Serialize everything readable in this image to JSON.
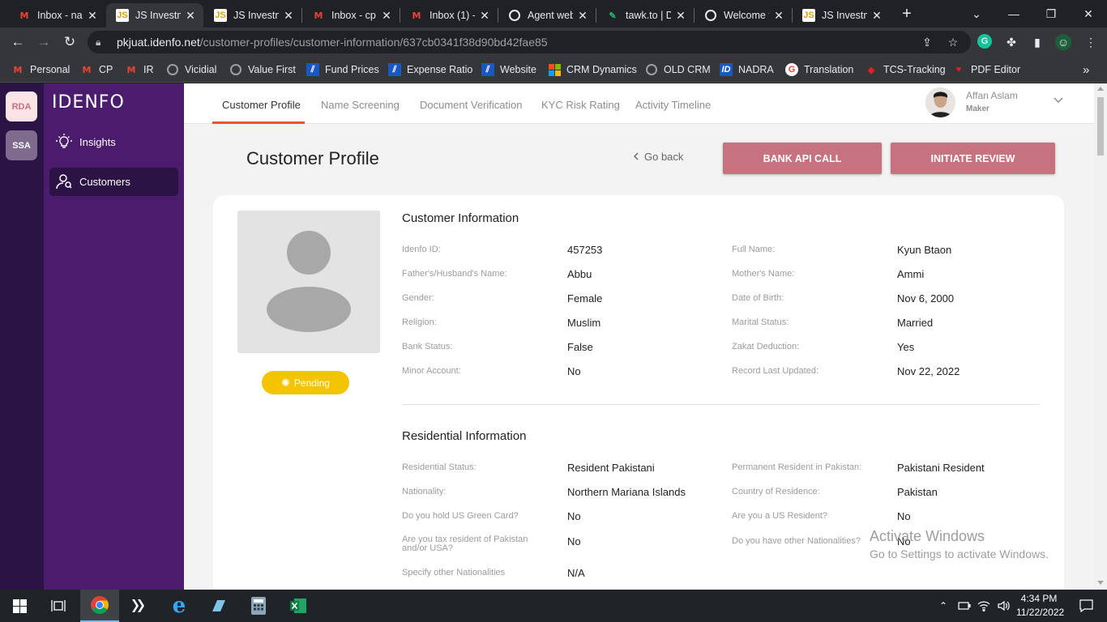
{
  "browser": {
    "tabs": [
      {
        "title": "Inbox - na",
        "icon": "gmail-icon"
      },
      {
        "title": "JS Investm",
        "icon": "js-icon"
      },
      {
        "title": "JS Investm",
        "icon": "js-icon"
      },
      {
        "title": "Inbox - cp",
        "icon": "gmail-icon"
      },
      {
        "title": "Inbox (1) -",
        "icon": "gmail-icon"
      },
      {
        "title": "Agent web",
        "icon": "globe-icon"
      },
      {
        "title": "tawk.to | D",
        "icon": "tawk-icon"
      },
      {
        "title": "Welcome t",
        "icon": "globe-icon"
      },
      {
        "title": "JS Investm",
        "icon": "js-icon"
      }
    ],
    "url_domain": "pkjuat.idenfo.net",
    "url_path": "/customer-profiles/customer-information/637cb0341f38d90bd42fae85",
    "bookmarks": [
      {
        "label": "Personal"
      },
      {
        "label": "CP"
      },
      {
        "label": "IR"
      },
      {
        "label": "Vicidial"
      },
      {
        "label": "Value First"
      },
      {
        "label": "Fund Prices"
      },
      {
        "label": "Expense Ratio"
      },
      {
        "label": "Website"
      },
      {
        "label": "CRM Dynamics"
      },
      {
        "label": "OLD CRM"
      },
      {
        "label": "NADRA"
      },
      {
        "label": "Translation"
      },
      {
        "label": "TCS-Tracking"
      },
      {
        "label": "PDF Editor"
      }
    ],
    "more_bookmarks": "»"
  },
  "app": {
    "rail": [
      "RDA",
      "SSA"
    ],
    "logo": "IDENFO",
    "nav": [
      {
        "label": "Insights",
        "icon": "lightbulb-icon"
      },
      {
        "label": "Customers",
        "icon": "users-icon"
      }
    ],
    "tabs": [
      "Customer Profile",
      "Name Screening",
      "Document Verification",
      "KYC Risk Rating",
      "Activity Timeline"
    ],
    "user": {
      "name": "Affan Aslam",
      "role": "Maker"
    },
    "page_title": "Customer Profile",
    "go_back": "Go back",
    "buttons": {
      "bank_api": "BANK API CALL",
      "initiate_review": "INITIATE REVIEW"
    },
    "status": "Pending",
    "customer_info": {
      "title": "Customer Information",
      "fields": [
        {
          "label": "Idenfo ID:",
          "value": "457253"
        },
        {
          "label": "Full Name:",
          "value": "Kyun Btaon"
        },
        {
          "label": "Father's/Husband's Name:",
          "value": "Abbu"
        },
        {
          "label": "Mother's Name:",
          "value": "Ammi"
        },
        {
          "label": "Gender:",
          "value": "Female"
        },
        {
          "label": "Date of Birth:",
          "value": "Nov 6, 2000"
        },
        {
          "label": "Religion:",
          "value": "Muslim"
        },
        {
          "label": "Marital Status:",
          "value": "Married"
        },
        {
          "label": "Bank Status:",
          "value": "False"
        },
        {
          "label": "Zakat Deduction:",
          "value": "Yes"
        },
        {
          "label": "Minor Account:",
          "value": "No"
        },
        {
          "label": "Record Last Updated:",
          "value": "Nov 22, 2022"
        }
      ]
    },
    "residential_info": {
      "title": "Residential Information",
      "fields": [
        {
          "label": "Residential Status:",
          "value": "Resident Pakistani"
        },
        {
          "label": "Permanent Resident in Pakistan:",
          "value": "Pakistani Resident"
        },
        {
          "label": "Nationality:",
          "value": "Northern Mariana Islands"
        },
        {
          "label": "Country of Residence:",
          "value": "Pakistan"
        },
        {
          "label": "Do you hold US Green Card?",
          "value": "No"
        },
        {
          "label": "Are you a US Resident?",
          "value": "No"
        },
        {
          "label": "Are you tax resident of Pakistan and/or USA?",
          "value": "No"
        },
        {
          "label": "Do you have other Nationalities?",
          "value": "No"
        },
        {
          "label": "Specify other Nationalities",
          "value": "N/A"
        }
      ]
    }
  },
  "watermark": {
    "line1": "Activate Windows",
    "line2": "Go to Settings to activate Windows."
  },
  "taskbar": {
    "time": "4:34 PM",
    "date": "11/22/2022"
  }
}
